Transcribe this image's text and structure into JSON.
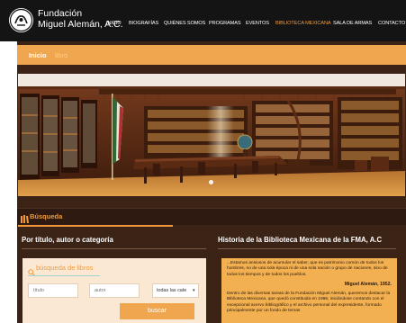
{
  "header": {
    "brand_line1": "Fundación",
    "brand_line2": "Miguel Alemán, A.C.",
    "logo_icon": "fma-circle-logo",
    "nav": [
      {
        "label": "INICIO",
        "active": false
      },
      {
        "label": "BIOGRAFÍAS",
        "active": false
      },
      {
        "label": "QUIÉNES SOMOS",
        "active": false
      },
      {
        "label": "PROGRAMAS",
        "active": false
      },
      {
        "label": "EVENTOS",
        "active": false
      },
      {
        "label": "BIBLIOTECA MEXICANA",
        "active": true
      },
      {
        "label": "SALA DE ARMAS",
        "active": false
      },
      {
        "label": "CONTACTO",
        "active": false
      }
    ]
  },
  "breadcrumb": {
    "home": "Inicio",
    "current": "libro"
  },
  "slider": {
    "image": "library-interior-photo",
    "active_dot": 1
  },
  "busqueda": {
    "icon": "library-icon",
    "title": "Búsqueda"
  },
  "left": {
    "heading": "Por título, autor o categoría",
    "search_icon": "search-icon",
    "search_title": "búsqueda de libros",
    "title_placeholder": "título",
    "author_placeholder": "autor",
    "category_selected": "todas las cate",
    "button": "buscar"
  },
  "right": {
    "heading": "Historia de la Biblioteca Mexicana de la FMA, A.C",
    "p1": "...Estamos ansiosos de acumular el saber, que es patrimonio común de todos los hombres, no de una sola época ni de una sola nación o grupo de naciones, sino de todos los tiempos y de todos los pueblos.",
    "signature": "Miguel Alemán, 1952.",
    "p2": "Dentro de las diversas tareas de la Fundación Miguel Alemán, queremos destacar la Biblioteca Mexicana, que quedó constituida en 1986, iniciándose contando con el excepcional acervo bibliográfico y el archivo personal del expresidente, formado principalmente por un fondo de temas"
  },
  "colors": {
    "accent": "#f29a3b",
    "brown": "#3b2316",
    "nav_bg": "#141414"
  }
}
